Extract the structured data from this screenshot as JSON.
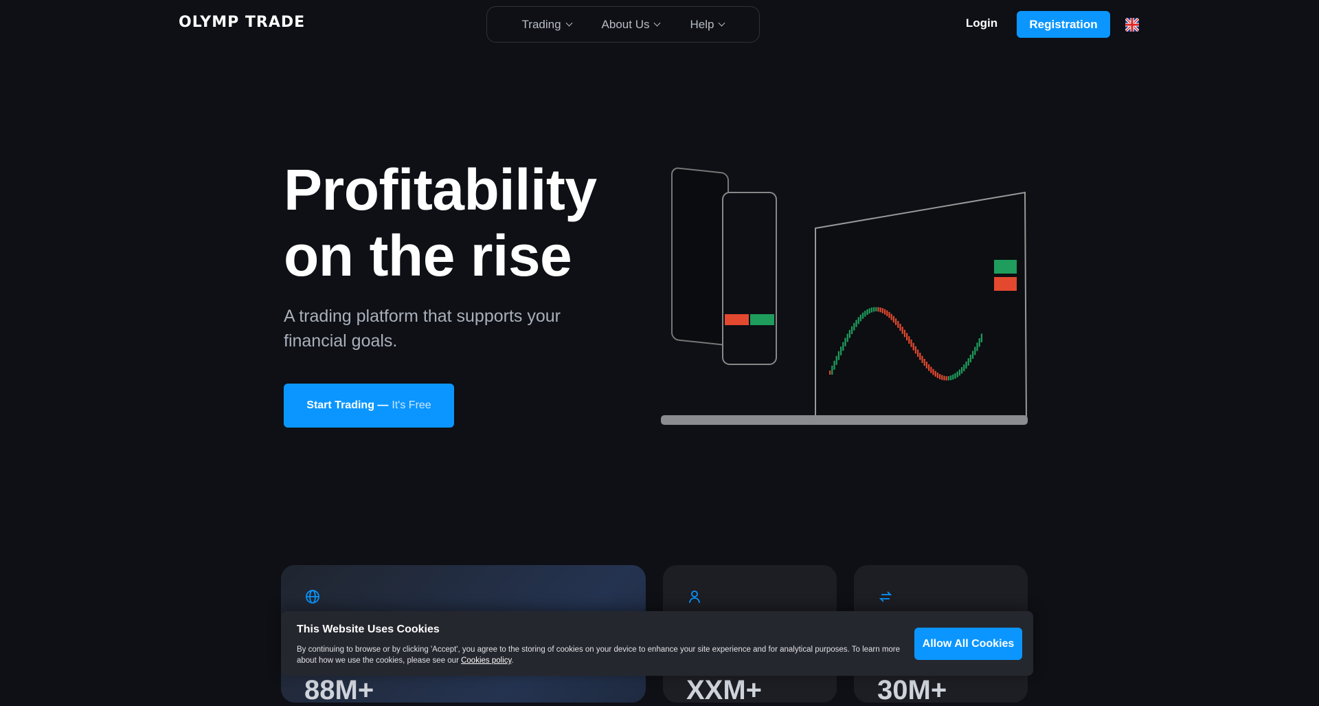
{
  "header": {
    "logo": "OLYMP TRADE",
    "nav": [
      {
        "label": "Trading"
      },
      {
        "label": "About Us"
      },
      {
        "label": "Help"
      }
    ],
    "login": "Login",
    "registration": "Registration",
    "language_flag": "uk-flag-icon"
  },
  "hero": {
    "title_line1": "Profitability",
    "title_line2": "on the rise",
    "subtitle": "A trading platform that supports your financial goals.",
    "cta_main": "Start Trading —",
    "cta_free": "It's Free"
  },
  "cards": [
    {
      "icon": "globe-icon",
      "stat": "88M+"
    },
    {
      "icon": "user-icon",
      "stat": "XXM+"
    },
    {
      "icon": "arrows-exchange-icon",
      "stat": "30M+"
    }
  ],
  "cookie": {
    "title": "This Website Uses Cookies",
    "text": "By continuing to browse or by clicking 'Accept', you agree to the storing of cookies on your device to enhance your site experience and for analytical purposes. To learn more about how we use the cookies, please see our",
    "link": "Cookies policy",
    "button": "Allow All Cookies"
  },
  "colors": {
    "accent": "#0b96ff",
    "background": "#0e1015",
    "buy": "#1f9d5c",
    "sell": "#e2492f"
  }
}
